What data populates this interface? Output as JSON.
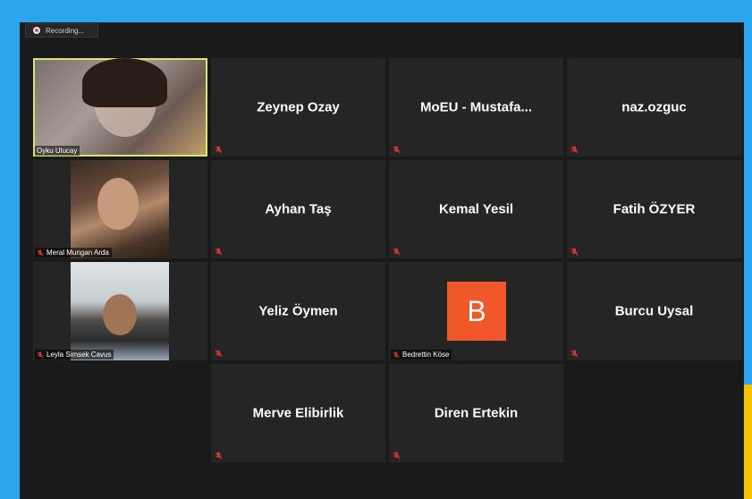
{
  "recording": {
    "label": "Recording..."
  },
  "participants": [
    {
      "name": "Oyku Ulucay",
      "type": "video"
    },
    {
      "name": "Zeynep Ozay",
      "type": "name"
    },
    {
      "name": "MoEU - Mustafa...",
      "type": "name"
    },
    {
      "name": "naz.ozguc",
      "type": "name"
    },
    {
      "name": "Meral Mungan Arda",
      "type": "video"
    },
    {
      "name": "Ayhan Taş",
      "type": "name"
    },
    {
      "name": "Kemal Yesil",
      "type": "name"
    },
    {
      "name": "Fatih ÖZYER",
      "type": "name"
    },
    {
      "name": "Leyla Simsek Cavus",
      "type": "video"
    },
    {
      "name": "Yeliz Öymen",
      "type": "name"
    },
    {
      "name": "Bedrettin Köse",
      "type": "avatar",
      "initial": "B"
    },
    {
      "name": "Burcu Uysal",
      "type": "name"
    },
    {
      "name": "Merve Elibirlik",
      "type": "name"
    },
    {
      "name": "Diren Ertekin",
      "type": "name"
    }
  ],
  "colors": {
    "background": "#2aa6ee",
    "active_speaker": "#d4e86a",
    "avatar": "#f0582a",
    "muted_icon": "#e0332f"
  },
  "icons": {
    "muted": "mic-muted-icon",
    "recording": "recording-icon"
  }
}
